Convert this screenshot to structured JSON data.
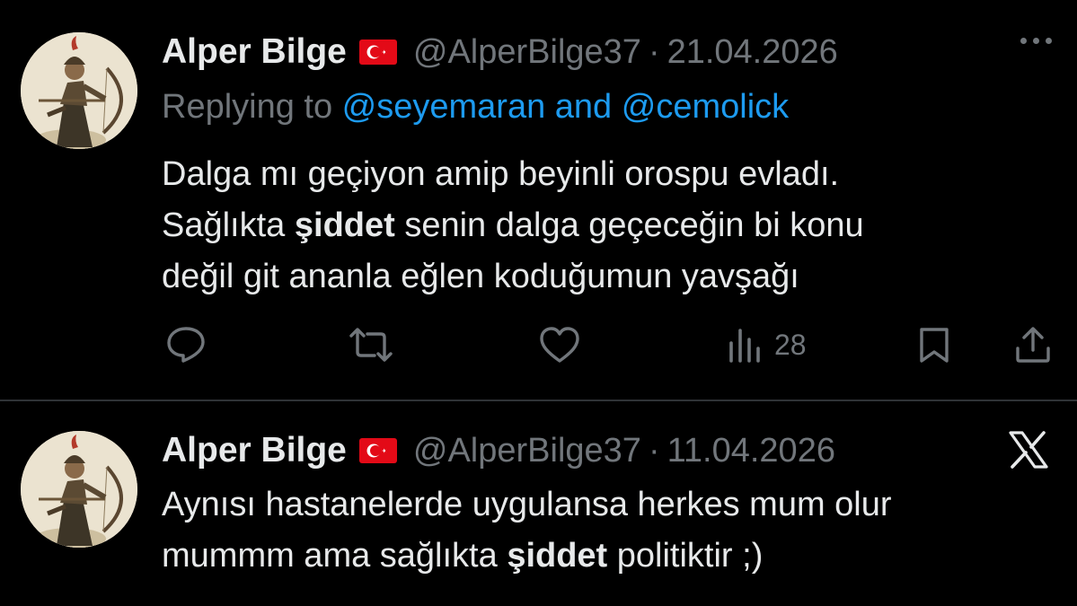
{
  "tweets": [
    {
      "name": "Alper Bilge",
      "flag": "turkey-flag",
      "handle": "@AlperBilge37",
      "separator": "·",
      "date": "21.04.2026",
      "reply_prefix": "Replying to ",
      "reply_user1": "@seyemaran",
      "reply_joiner": " and ",
      "reply_user2": "@cemolick",
      "lines": [
        {
          "pre": "Dalga mı geçiyon amip beyinli orospu evladı.",
          "bold": "",
          "post": ""
        },
        {
          "pre": "Sağlıkta ",
          "bold": "şiddet",
          "post": " senin dalga geçeceğin bi konu"
        },
        {
          "pre": "değil git ananla eğlen koduğumun yavşağı",
          "bold": "",
          "post": ""
        }
      ],
      "views": "28"
    },
    {
      "name": "Alper Bilge",
      "flag": "turkey-flag",
      "handle": "@AlperBilge37",
      "separator": "·",
      "date": "11.04.2026",
      "lines": [
        {
          "pre": "Aynısı hastanelerde uygulansa herkes mum olur",
          "bold": "",
          "post": ""
        },
        {
          "pre": "mummm ama sağlıkta ",
          "bold": "şiddet",
          "post": " politiktir ;)"
        }
      ]
    }
  ],
  "icons": {
    "reply": "reply-icon",
    "retweet": "retweet-icon",
    "like": "like-icon",
    "views": "views-icon",
    "bookmark": "bookmark-icon",
    "share": "share-icon",
    "more": "more-icon",
    "brand": "x-logo-icon"
  },
  "colors": {
    "background": "#000000",
    "text": "#e7e9ea",
    "secondary": "#71767b",
    "link": "#1d9bf0",
    "divider": "#2f3336"
  }
}
